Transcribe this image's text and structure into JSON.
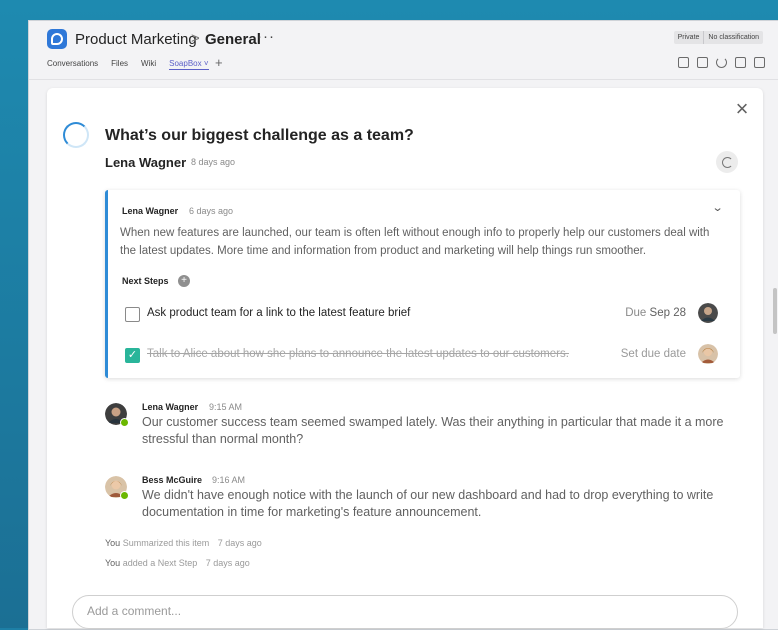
{
  "header": {
    "team_name": "Product Marketing",
    "separator": ">",
    "channel_name": "General",
    "more_label": "···",
    "badge_private": "Private",
    "badge_classification": "No classification"
  },
  "tabs": [
    {
      "label": "Conversations",
      "active": false
    },
    {
      "label": "Files",
      "active": false
    },
    {
      "label": "Wiki",
      "active": false
    },
    {
      "label": "SoapBox ˅",
      "active": true
    }
  ],
  "tab_add_label": "+",
  "question": {
    "title": "What’s our biggest challenge as a team?",
    "author": "Lena Wagner",
    "time": "8 days ago"
  },
  "summary": {
    "author": "Lena Wagner",
    "time": "6 days ago",
    "body": "When new features are launched, our team is often left without enough info to properly help our customers deal with the latest updates. More time and information from product and marketing will help things run smoother.",
    "next_steps_label": "Next Steps",
    "tasks": [
      {
        "text": "Ask product team for a link to the latest feature brief",
        "due_prefix": "Due",
        "due_date": "Sep 28",
        "done": false
      },
      {
        "text": "Talk to Alice about how she plans to announce the latest updates to our customers.",
        "due_text": "Set due date",
        "done": true
      }
    ]
  },
  "comments": [
    {
      "author": "Lena Wagner",
      "time": "9:15 AM",
      "text": "Our customer success team seemed swamped lately. Was their anything in particular that made it a more stressful than normal month?"
    },
    {
      "author": "Bess McGuire",
      "time": "9:16 AM",
      "text": "We didn't have enough notice with the launch of our new dashboard and had to drop everything to write documentation in time for marketing's feature announcement."
    }
  ],
  "activity": [
    {
      "actor": "You",
      "action": "Summarized this item",
      "time": "7 days ago"
    },
    {
      "actor": "You",
      "action": "added a Next Step",
      "time": "7 days ago"
    }
  ],
  "comment_input": {
    "placeholder": "Add a comment...",
    "value": ""
  },
  "colors": {
    "accent": "#5b5fc7",
    "spinner": "#2e8bd6",
    "check": "#29b59a",
    "presence": "#6bb700"
  }
}
